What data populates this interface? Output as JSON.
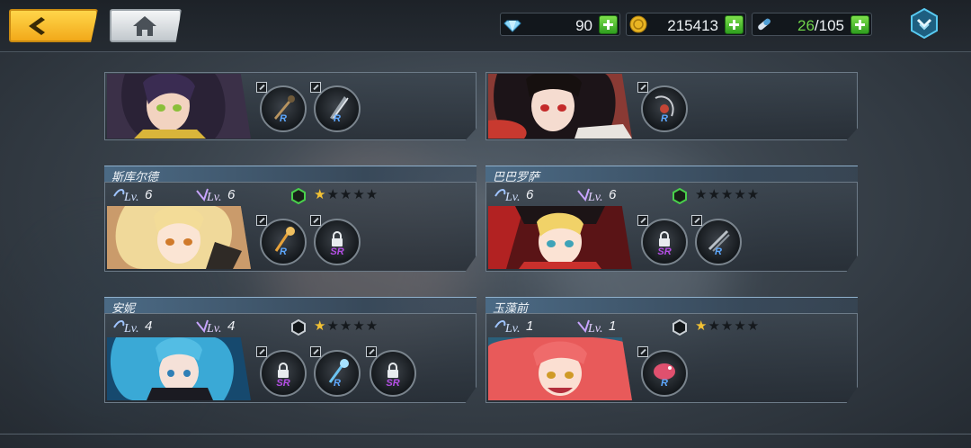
{
  "topbar": {
    "gems": "90",
    "gold": "215413",
    "stamina_current": "26",
    "stamina_separator": "/105"
  },
  "icons": {
    "back": "chevron-left-icon",
    "home": "home-icon",
    "gem": "diamond-icon",
    "gold": "coin-icon",
    "stamina": "capsule-icon",
    "menu": "expand-menu-icon"
  },
  "colors": {
    "back_button": "#f2a91a",
    "plus_button": "#3aa82a",
    "star_on": "#f3c234",
    "rank_r": "#5da8ff",
    "rank_sr": "#b54ee6"
  },
  "cards": [
    {
      "name": "",
      "slots": [
        {
          "rank": "R",
          "locked": false
        },
        {
          "rank": "R",
          "locked": false
        }
      ]
    },
    {
      "name": "",
      "slots": [
        {
          "rank": "R",
          "locked": false
        }
      ]
    },
    {
      "name": "斯库尔德",
      "lv1": "6",
      "lv2": "6",
      "stars": 1,
      "hex": "green",
      "slots": [
        {
          "rank": "R",
          "locked": false
        },
        {
          "rank": "SR",
          "locked": true
        }
      ]
    },
    {
      "name": "巴巴罗萨",
      "lv1": "6",
      "lv2": "6",
      "stars": 0,
      "hex": "green",
      "slots": [
        {
          "rank": "SR",
          "locked": true
        },
        {
          "rank": "R",
          "locked": false
        }
      ]
    },
    {
      "name": "安妮",
      "lv1": "4",
      "lv2": "4",
      "stars": 1,
      "hex": "dark",
      "slots": [
        {
          "rank": "SR",
          "locked": true
        },
        {
          "rank": "R",
          "locked": false
        },
        {
          "rank": "SR",
          "locked": true
        }
      ]
    },
    {
      "name": "玉藻前",
      "lv1": "1",
      "lv2": "1",
      "stars": 1,
      "hex": "dark",
      "slots": [
        {
          "rank": "R",
          "locked": false
        }
      ]
    }
  ]
}
